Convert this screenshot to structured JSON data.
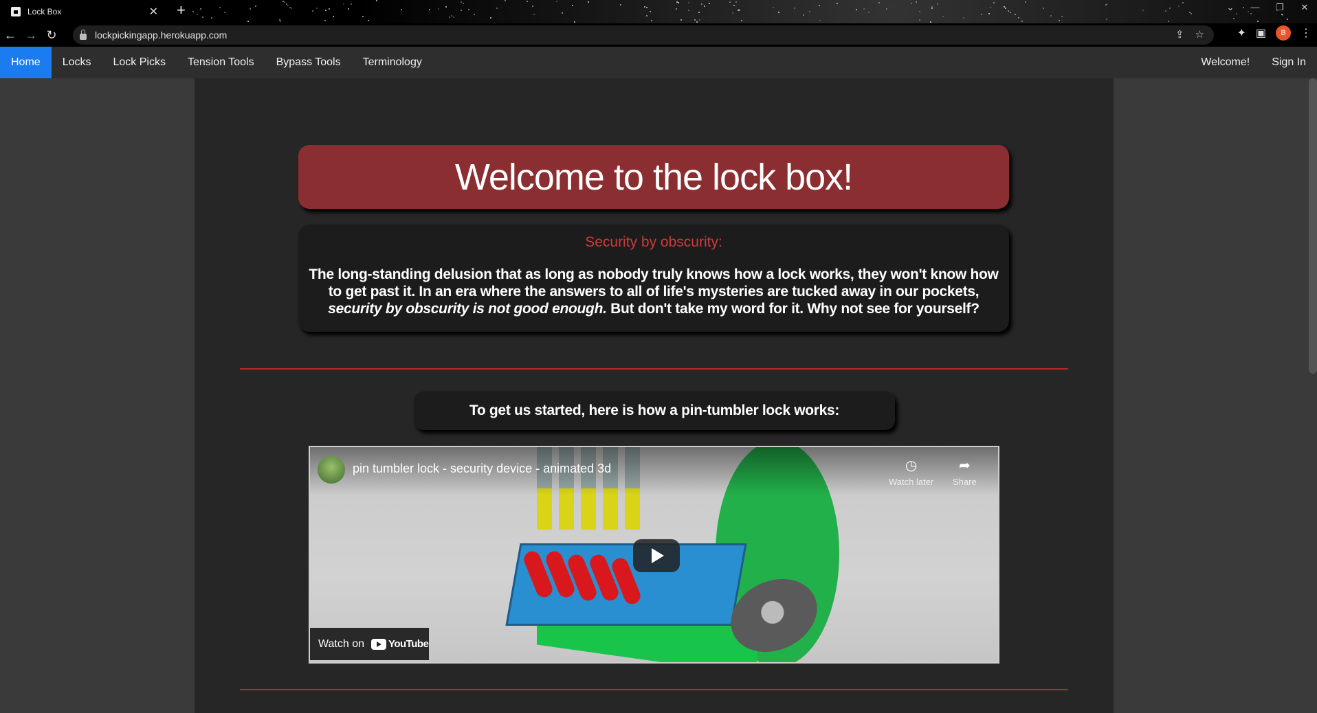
{
  "browser": {
    "tab_title": "Lock Box",
    "tab_close": "✕",
    "new_tab": "+",
    "url": "lockpickingapp.herokuapp.com",
    "profile_initial": "B",
    "window_controls": [
      "⌄",
      "—",
      "❐",
      "✕"
    ]
  },
  "nav": {
    "items": [
      {
        "label": "Home",
        "active": true
      },
      {
        "label": "Locks"
      },
      {
        "label": "Lock Picks"
      },
      {
        "label": "Tension Tools"
      },
      {
        "label": "Bypass Tools"
      },
      {
        "label": "Terminology"
      }
    ],
    "welcome": "Welcome!",
    "sign_in": "Sign In"
  },
  "hero": {
    "title": "Welcome to the lock box!"
  },
  "intro": {
    "subtitle": "Security by obscurity:",
    "text_before": "The long-standing delusion that as long as nobody truly knows how a lock works, they won't know how to get past it. In an era where the answers to all of life's mysteries are tucked away in our pockets, ",
    "text_italic": "security by obscurity is not good enough.",
    "text_after": " But don't take my word for it. Why not see for yourself?"
  },
  "getting_started": "To get us started, here is how a pin-tumbler lock works:",
  "video": {
    "title": "pin tumbler lock - security device - animated 3d",
    "watch_later": "Watch later",
    "share": "Share",
    "watch_on": "Watch on",
    "youtube": "YouTube"
  },
  "colors": {
    "accent_blue": "#1a7cf0",
    "hero_red": "#8b2e31",
    "subtitle_red": "#cf3b3b",
    "rule_red": "#b52a2a"
  }
}
